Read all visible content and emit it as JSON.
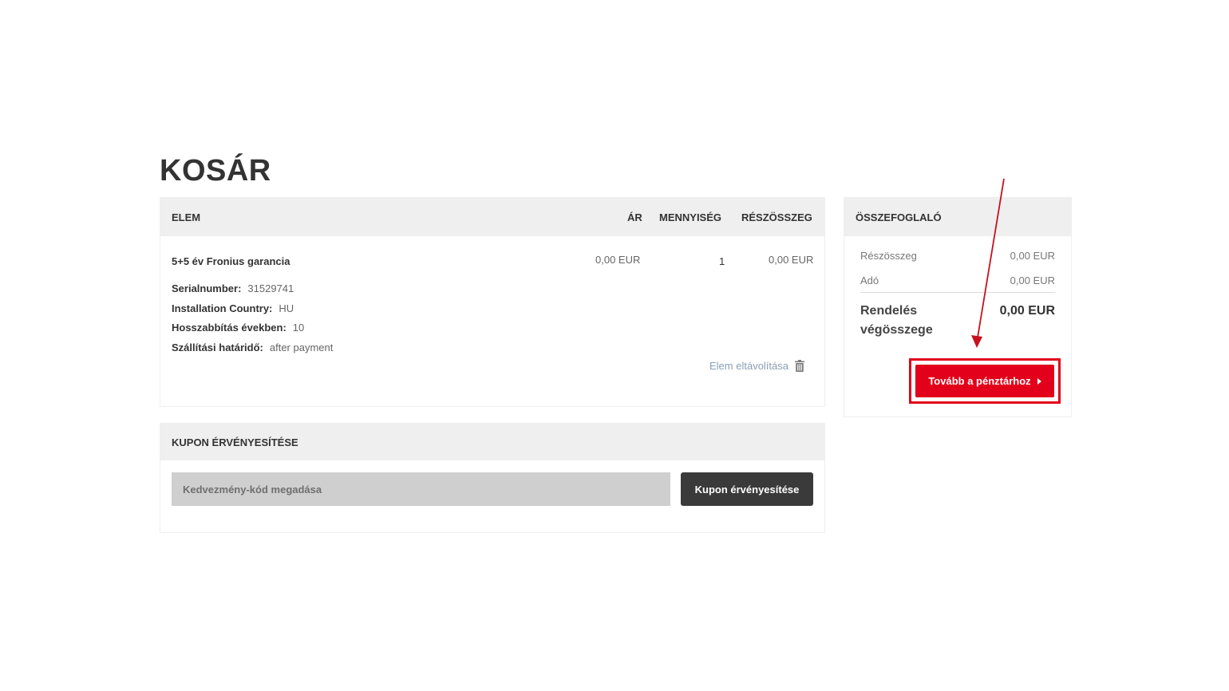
{
  "page": {
    "title": "KOSÁR"
  },
  "cart": {
    "headers": {
      "item": "ELEM",
      "price": "ÁR",
      "quantity": "MENNYISÉG",
      "subtotal": "RÉSZÖSSZEG"
    },
    "item": {
      "name": "5+5 év Fronius garancia",
      "price": "0,00 EUR",
      "quantity": "1",
      "subtotal": "0,00 EUR",
      "attributes": [
        {
          "label": "Serialnumber:",
          "value": "31529741"
        },
        {
          "label": "Installation Country:",
          "value": "HU"
        },
        {
          "label": "Hosszabbítás években:",
          "value": "10"
        },
        {
          "label": "Szállítási határidő:",
          "value": "after payment"
        }
      ],
      "remove_label": "Elem eltávolítása",
      "remove_icon": "trash-icon"
    }
  },
  "coupon": {
    "header": "KUPON ÉRVÉNYESÍTÉSE",
    "placeholder": "Kedvezmény-kód megadása",
    "button_label": "Kupon érvényesítése"
  },
  "summary": {
    "header": "ÖSSZEFOGLALÓ",
    "subtotal_label": "Részösszeg",
    "subtotal_value": "0,00 EUR",
    "tax_label": "Adó",
    "tax_value": "0,00 EUR",
    "total_label": "Rendelés végösszege",
    "total_value": "0,00 EUR",
    "checkout_label": "Tovább a pénztárhoz",
    "checkout_icon": "caret-right-icon"
  },
  "colors": {
    "accent": "#e2001a",
    "header_bg": "#efefef",
    "dark_button": "#3a3a3a"
  }
}
